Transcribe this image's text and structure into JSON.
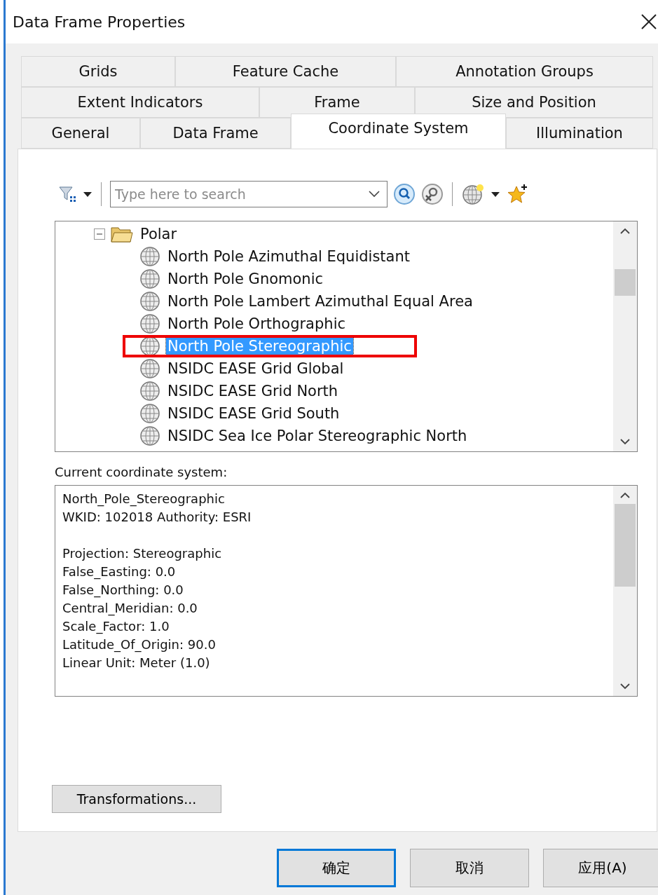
{
  "window": {
    "title": "Data Frame Properties"
  },
  "tab_rows": [
    [
      {
        "label": "Grids",
        "selected": false
      },
      {
        "label": "Feature Cache",
        "selected": false
      },
      {
        "label": "Annotation Groups",
        "selected": false
      }
    ],
    [
      {
        "label": "Extent Indicators",
        "selected": false
      },
      {
        "label": "Frame",
        "selected": false
      },
      {
        "label": "Size and Position",
        "selected": false
      }
    ],
    [
      {
        "label": "General",
        "selected": false
      },
      {
        "label": "Data Frame",
        "selected": false
      },
      {
        "label": "Coordinate System",
        "selected": true
      },
      {
        "label": "Illumination",
        "selected": false
      }
    ]
  ],
  "search": {
    "placeholder": "Type here to search"
  },
  "tree": [
    {
      "label": "Polar",
      "kind": "folder",
      "expanded": true,
      "children": [
        {
          "label": "North Pole Azimuthal Equidistant",
          "kind": "projection",
          "selected": false
        },
        {
          "label": "North Pole Gnomonic",
          "kind": "projection",
          "selected": false
        },
        {
          "label": "North Pole Lambert Azimuthal Equal Area",
          "kind": "projection",
          "selected": false
        },
        {
          "label": "North Pole Orthographic",
          "kind": "projection",
          "selected": false
        },
        {
          "label": "North Pole Stereographic",
          "kind": "projection",
          "selected": true
        },
        {
          "label": "NSIDC EASE Grid Global",
          "kind": "projection",
          "selected": false
        },
        {
          "label": "NSIDC EASE Grid North",
          "kind": "projection",
          "selected": false
        },
        {
          "label": "NSIDC EASE Grid South",
          "kind": "projection",
          "selected": false
        },
        {
          "label": "NSIDC Sea Ice Polar Stereographic North",
          "kind": "projection",
          "selected": false
        }
      ]
    }
  ],
  "current": {
    "label": "Current coordinate system:",
    "groups": [
      [
        "North_Pole_Stereographic",
        "WKID: 102018 Authority: ESRI"
      ],
      [
        "Projection: Stereographic",
        "False_Easting: 0.0",
        "False_Northing: 0.0",
        "Central_Meridian: 0.0",
        "Scale_Factor: 1.0",
        "Latitude_Of_Origin: 90.0",
        "Linear Unit: Meter (1.0)"
      ]
    ]
  },
  "transformations_button": "Transformations...",
  "buttons": [
    {
      "label": "确定",
      "kind": "default"
    },
    {
      "label": "取消",
      "kind": "normal"
    },
    {
      "label": "应用(A)",
      "kind": "normal"
    }
  ]
}
